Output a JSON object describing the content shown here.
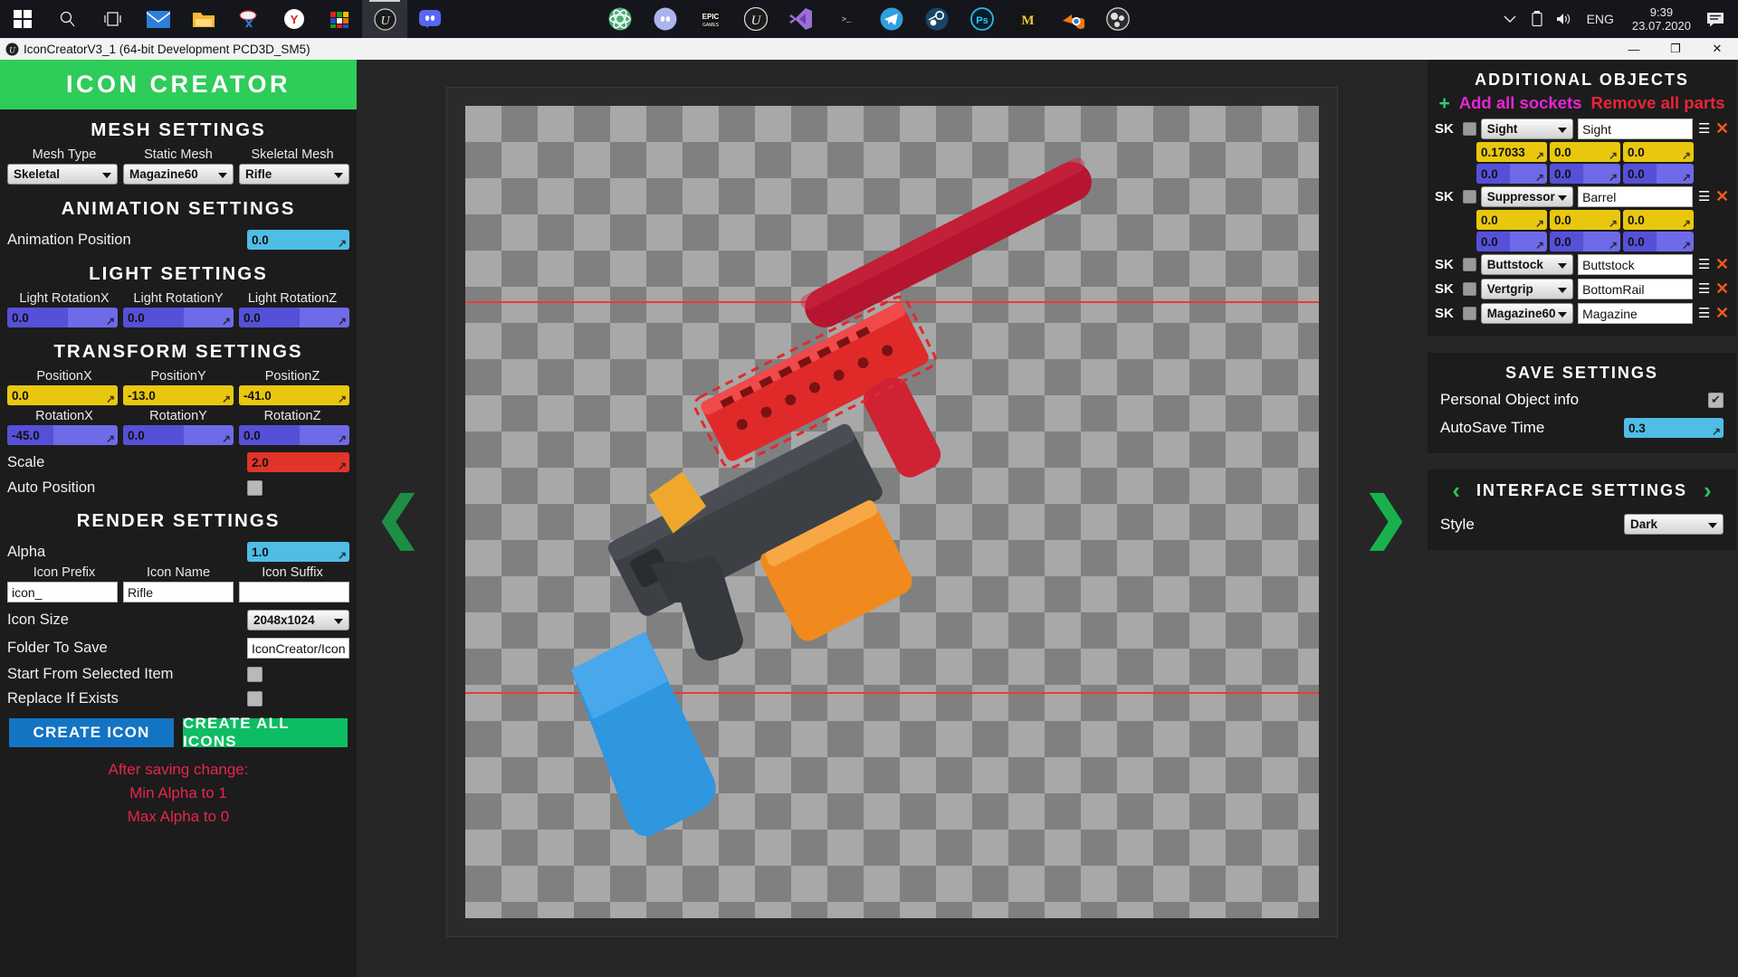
{
  "taskbar": {
    "left_items": [
      {
        "name": "start-button",
        "icon": "windows-logo"
      },
      {
        "name": "search-button",
        "icon": "search-icon"
      },
      {
        "name": "task-view-button",
        "icon": "task-view-icon"
      },
      {
        "name": "mail-app",
        "icon": "mail-icon"
      },
      {
        "name": "file-explorer",
        "icon": "folder-icon"
      },
      {
        "name": "snip-tool",
        "icon": "snip-icon"
      },
      {
        "name": "yandex-browser",
        "icon": "yandex-icon"
      },
      {
        "name": "rubiks-app",
        "icon": "cube-icon"
      },
      {
        "name": "unreal-engine",
        "icon": "unreal-icon"
      },
      {
        "name": "discord-taskbar",
        "icon": "discord-icon"
      }
    ],
    "center_items": [
      {
        "name": "atom-editor",
        "icon": "atom-icon"
      },
      {
        "name": "discord",
        "icon": "discord-icon"
      },
      {
        "name": "epic-games",
        "icon": "epic-games-icon",
        "label": "EPIC",
        "sub": "GAMES"
      },
      {
        "name": "unreal-engine",
        "icon": "unreal-icon"
      },
      {
        "name": "visual-studio",
        "icon": "visual-studio-icon"
      },
      {
        "name": "terminal",
        "icon": "terminal-icon"
      },
      {
        "name": "telegram",
        "icon": "telegram-icon"
      },
      {
        "name": "steam",
        "icon": "steam-icon"
      },
      {
        "name": "photoshop",
        "icon": "photoshop-icon",
        "label": "Ps"
      },
      {
        "name": "marmoset",
        "icon": "marmoset-icon",
        "label": "M"
      },
      {
        "name": "blender",
        "icon": "blender-icon"
      },
      {
        "name": "obs-studio",
        "icon": "obs-icon"
      }
    ],
    "tray": {
      "show_hidden": "chevron-up-icon",
      "battery": "battery-icon",
      "volume": "speaker-icon",
      "language": "ENG",
      "time": "9:39",
      "date": "23.07.2020",
      "notifications": "notification-icon"
    }
  },
  "window": {
    "title": "IconCreatorV3_1 (64-bit Development PCD3D_SM5)",
    "minimize": "—",
    "maximize": "❐",
    "close": "✕"
  },
  "brand": {
    "title": "ICON CREATOR"
  },
  "mesh_settings": {
    "heading": "MESH SETTINGS",
    "labels": [
      "Mesh Type",
      "Static Mesh",
      "Skeletal Mesh"
    ],
    "values": [
      "Skeletal",
      "Magazine60",
      "Rifle"
    ]
  },
  "animation_settings": {
    "heading": "ANIMATION SETTINGS",
    "position_label": "Animation Position",
    "position_value": "0.0"
  },
  "light_settings": {
    "heading": "LIGHT SETTINGS",
    "labels": [
      "Light RotationX",
      "Light RotationY",
      "Light RotationZ"
    ],
    "values": [
      "0.0",
      "0.0",
      "0.0"
    ]
  },
  "transform_settings": {
    "heading": "TRANSFORM SETTINGS",
    "position_labels": [
      "PositionX",
      "PositionY",
      "PositionZ"
    ],
    "position_values": [
      "0.0",
      "-13.0",
      "-41.0"
    ],
    "rotation_labels": [
      "RotationX",
      "RotationY",
      "RotationZ"
    ],
    "rotation_values": [
      "-45.0",
      "0.0",
      "0.0"
    ],
    "scale_label": "Scale",
    "scale_value": "2.0",
    "auto_position_label": "Auto Position",
    "auto_position_checked": false
  },
  "render_settings": {
    "heading": "RENDER SETTINGS",
    "alpha_label": "Alpha",
    "alpha_value": "1.0",
    "name_labels": [
      "Icon Prefix",
      "Icon Name",
      "Icon Suffix"
    ],
    "name_values": [
      "icon_",
      "Rifle",
      ""
    ],
    "icon_size_label": "Icon Size",
    "icon_size_value": "2048x1024",
    "folder_label": "Folder To Save",
    "folder_value": "IconCreator/Icon",
    "start_from_selected_label": "Start From Selected Item",
    "start_from_selected_checked": false,
    "replace_if_exists_label": "Replace If Exists",
    "replace_if_exists_checked": false,
    "create_icon_label": "CREATE ICON",
    "create_all_icons_label": "CREATE ALL ICONS",
    "warning_lines": [
      "After saving change:",
      "Min Alpha to 1",
      "Max Alpha to 0"
    ]
  },
  "viewport": {
    "prev_arrow": "❮",
    "next_arrow": "❯"
  },
  "additional_objects": {
    "heading": "ADDITIONAL OBJECTS",
    "add_icon": "+",
    "add_all_sockets": "Add all sockets",
    "remove_all_parts": "Remove all parts",
    "rows": [
      {
        "type": "SK",
        "checked": false,
        "mesh": "Sight",
        "socket": "Sight",
        "menu_icon": "list-icon",
        "delete_icon": "✕",
        "position": [
          "0.17033",
          "0.0",
          "0.0"
        ],
        "rotation": [
          "0.0",
          "0.0",
          "0.0"
        ],
        "expanded": true
      },
      {
        "type": "SK",
        "checked": false,
        "mesh": "Suppressor",
        "socket": "Barrel",
        "menu_icon": "list-icon",
        "delete_icon": "✕",
        "position": [
          "0.0",
          "0.0",
          "0.0"
        ],
        "rotation": [
          "0.0",
          "0.0",
          "0.0"
        ],
        "expanded": true
      },
      {
        "type": "SK",
        "checked": false,
        "mesh": "Buttstock",
        "socket": "Buttstock",
        "menu_icon": "list-icon",
        "delete_icon": "✕",
        "expanded": false
      },
      {
        "type": "SK",
        "checked": false,
        "mesh": "Vertgrip",
        "socket": "BottomRail",
        "menu_icon": "list-icon",
        "delete_icon": "✕",
        "expanded": false
      },
      {
        "type": "SK",
        "checked": false,
        "mesh": "Magazine60",
        "socket": "Magazine",
        "menu_icon": "list-icon",
        "delete_icon": "✕",
        "expanded": false
      }
    ]
  },
  "save_settings": {
    "heading": "SAVE SETTINGS",
    "personal_object_label": "Personal Object info",
    "personal_object_checked": true,
    "autosave_label": "AutoSave Time",
    "autosave_value": "0.3"
  },
  "interface_settings": {
    "heading": "INTERFACE SETTINGS",
    "prev_arrow": "‹",
    "next_arrow": "›",
    "style_label": "Style",
    "style_value": "Dark"
  },
  "colors": {
    "brand_green": "#2ecc58",
    "accent_magenta": "#e824d8",
    "accent_red": "#e8243a",
    "spin_purple": "#6e6ae8",
    "spin_yellow": "#f2cf1b",
    "spin_cyan": "#5fc6ea",
    "spin_red": "#e8473a",
    "create_icon_blue": "#1474c4",
    "create_all_green": "#0dbd63"
  }
}
